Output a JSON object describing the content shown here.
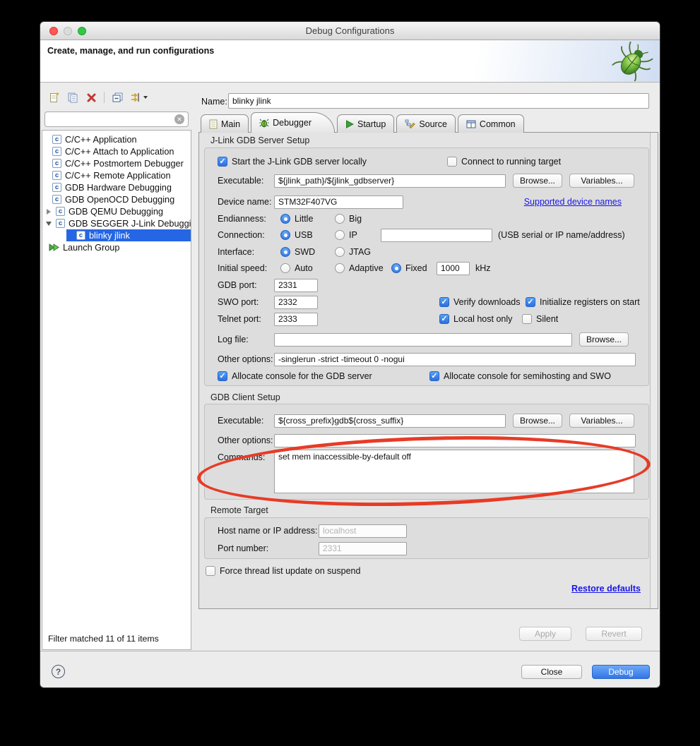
{
  "window": {
    "title": "Debug Configurations"
  },
  "header": {
    "title": "Create, manage, and run configurations"
  },
  "sidebar": {
    "filter_status": "Filter matched 11 of 11 items",
    "type_letter": "c",
    "tree": [
      {
        "label": "C/C++ Application",
        "selected": false
      },
      {
        "label": "C/C++ Attach to Application",
        "selected": false
      },
      {
        "label": "C/C++ Postmortem Debugger",
        "selected": false
      },
      {
        "label": "C/C++ Remote Application",
        "selected": false
      },
      {
        "label": "GDB Hardware Debugging",
        "selected": false
      },
      {
        "label": "GDB OpenOCD Debugging",
        "selected": false
      },
      {
        "label": "GDB QEMU Debugging",
        "selected": false
      },
      {
        "label": "GDB SEGGER J-Link Debuggi",
        "selected": false
      },
      {
        "label": "blinky jlink",
        "selected": true
      },
      {
        "label": "Launch Group",
        "selected": false
      }
    ]
  },
  "name_row": {
    "label": "Name:",
    "value": "blinky jlink"
  },
  "tabs": [
    {
      "label": "Main",
      "active": false
    },
    {
      "label": "Debugger",
      "active": true
    },
    {
      "label": "Startup",
      "active": false
    },
    {
      "label": "Source",
      "active": false
    },
    {
      "label": "Common",
      "active": false
    }
  ],
  "server": {
    "title": "J-Link GDB Server Setup",
    "start_local": {
      "label": "Start the J-Link GDB server locally",
      "checked": true
    },
    "connect_running": {
      "label": "Connect to running target",
      "checked": false
    },
    "executable": {
      "label": "Executable:",
      "value": "${jlink_path}/${jlink_gdbserver}"
    },
    "device": {
      "label": "Device name:",
      "value": "STM32F407VG",
      "link": "Supported device names"
    },
    "endianness": {
      "label": "Endianness:",
      "little": {
        "label": "Little",
        "selected": true
      },
      "big": {
        "label": "Big",
        "selected": false
      }
    },
    "connection": {
      "label": "Connection:",
      "usb": {
        "label": "USB",
        "selected": true
      },
      "ip": {
        "label": "IP",
        "selected": false
      },
      "value": "",
      "hint": "(USB serial or IP name/address)"
    },
    "interface": {
      "label": "Interface:",
      "swd": {
        "label": "SWD",
        "selected": true
      },
      "jtag": {
        "label": "JTAG",
        "selected": false
      }
    },
    "speed": {
      "label": "Initial speed:",
      "auto": {
        "label": "Auto",
        "selected": false
      },
      "adaptive": {
        "label": "Adaptive",
        "selected": false
      },
      "fixed": {
        "label": "Fixed",
        "selected": true
      },
      "value": "1000",
      "unit": "kHz"
    },
    "gdb_port": {
      "label": "GDB port:",
      "value": "2331"
    },
    "swo_port": {
      "label": "SWO port:",
      "value": "2332"
    },
    "telnet_port": {
      "label": "Telnet port:",
      "value": "2333"
    },
    "verify_downloads": {
      "label": "Verify downloads",
      "checked": true
    },
    "init_registers": {
      "label": "Initialize registers on start",
      "checked": true
    },
    "local_host_only": {
      "label": "Local host only",
      "checked": true
    },
    "silent": {
      "label": "Silent",
      "checked": false
    },
    "log_file": {
      "label": "Log file:",
      "value": ""
    },
    "other_options": {
      "label": "Other options:",
      "value": "-singlerun -strict -timeout 0 -nogui"
    },
    "alloc_gdb": {
      "label": "Allocate console for the GDB server",
      "checked": true
    },
    "alloc_swo": {
      "label": "Allocate console for semihosting and SWO",
      "checked": true
    }
  },
  "client": {
    "title": "GDB Client Setup",
    "executable": {
      "label": "Executable:",
      "value": "${cross_prefix}gdb${cross_suffix}"
    },
    "other_options": {
      "label": "Other options:",
      "value": ""
    },
    "commands": {
      "label": "Commands:",
      "value": "set mem inaccessible-by-default off"
    }
  },
  "remote": {
    "title": "Remote Target",
    "host": {
      "label": "Host name or IP address:",
      "value": "localhost"
    },
    "port": {
      "label": "Port number:",
      "value": "2331"
    }
  },
  "footer_tab": {
    "force_thread": {
      "label": "Force thread list update on suspend",
      "checked": false
    },
    "restore_defaults": "Restore defaults"
  },
  "buttons": {
    "browse": "Browse...",
    "variables": "Variables...",
    "apply": "Apply",
    "revert": "Revert",
    "close": "Close",
    "debug": "Debug",
    "help": "?"
  },
  "colors": {
    "accent_blue": "#2b70e0",
    "selected_row_blue": "#2466e4",
    "link_blue": "#1a16e6",
    "annotation_red": "#e73b26",
    "debug_button_blue": "#3276e5"
  }
}
